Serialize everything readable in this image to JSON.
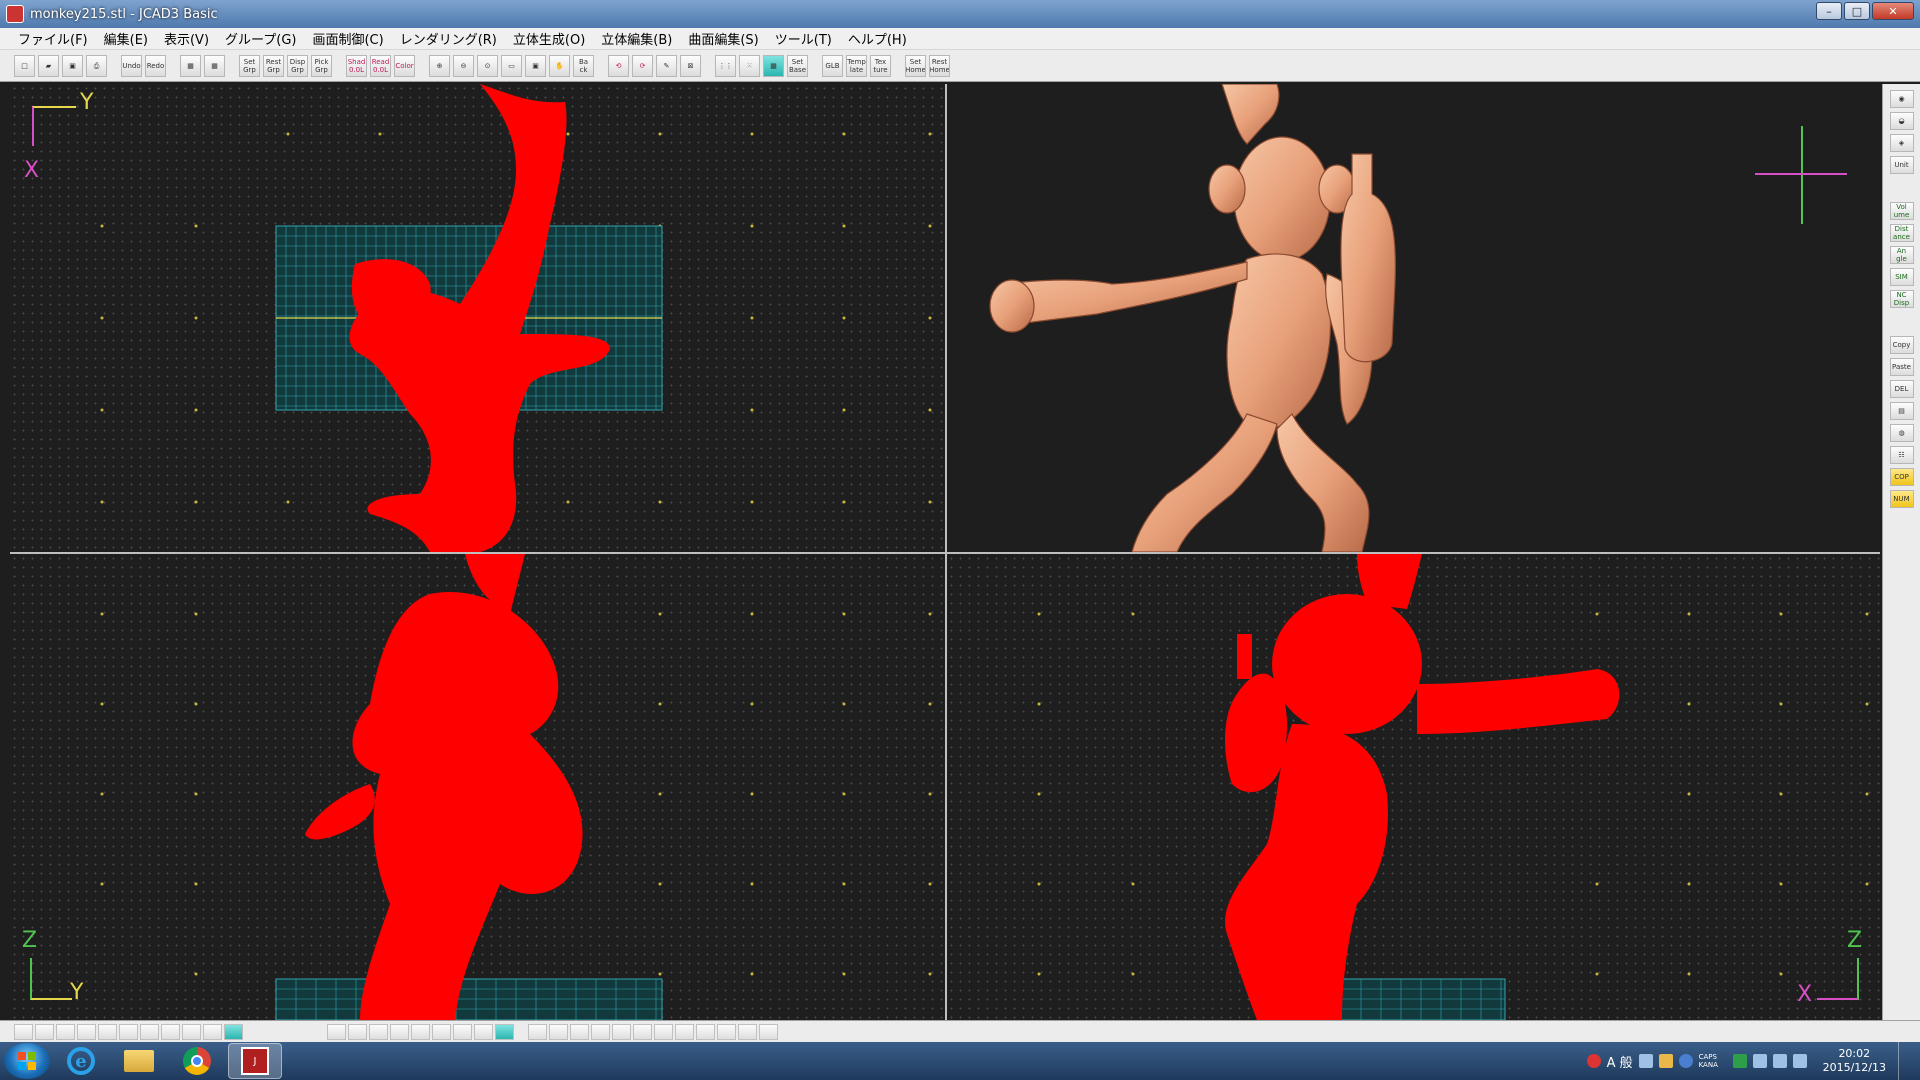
{
  "window": {
    "title": "monkey215.stl - JCAD3 Basic",
    "controls": {
      "minimize": "–",
      "maximize": "□",
      "close": "✕"
    }
  },
  "menu": {
    "items": [
      "ファイル(F)",
      "編集(E)",
      "表示(V)",
      "グループ(G)",
      "画面制御(C)",
      "レンダリング(R)",
      "立体生成(O)",
      "立体編集(B)",
      "曲面編集(S)",
      "ツール(T)",
      "ヘルプ(H)"
    ]
  },
  "toolbar": {
    "groups": [
      [
        "new",
        "open",
        "save",
        "print"
      ],
      [
        "Undo",
        "Redo"
      ],
      [
        "grid1",
        "grid2"
      ],
      [
        "Set Grp",
        "Rest Grp",
        "Disp Grp",
        "Pick Grp"
      ],
      [
        "Shad 0.0L",
        "Read 0.0L",
        "Color"
      ],
      [
        "zoom-in",
        "zoom-out",
        "zoom-fit",
        "zoom-window",
        "zoom-all",
        "pan",
        "Ba ck"
      ],
      [
        "rot1",
        "rot2",
        "rot3",
        "rot4"
      ],
      [
        "grid-a",
        "grid-b",
        "grid-c",
        "Set Base"
      ],
      [
        "GLB",
        "Temp late",
        "Tex ture"
      ],
      [
        "Set Home",
        "Rest Home"
      ]
    ]
  },
  "viewports": {
    "top_left": {
      "axis_h": "Y",
      "axis_v": "X",
      "view": "plan"
    },
    "top_right": {
      "view": "shaded-perspective"
    },
    "bottom_left": {
      "axis_h": "Y",
      "axis_v": "Z",
      "view": "side"
    },
    "bottom_right": {
      "axis_h": "X",
      "axis_v": "Z",
      "view": "front"
    }
  },
  "right_palette": {
    "buttons": [
      "eye",
      "bowl",
      "cube",
      "Unit",
      "Vol ume",
      "Dist ance",
      "An gle",
      "SIM",
      "NC Disp",
      "Copy",
      "Paste",
      "DEL",
      "icon-a",
      "icon-b",
      "icon-c",
      "COP",
      "NUM"
    ]
  },
  "taskbar": {
    "apps": [
      "start",
      "internet-explorer",
      "file-explorer",
      "chrome",
      "jcad3"
    ],
    "tray": {
      "ime": "A 般",
      "caps": "CAPS KANA",
      "time": "20:02",
      "date": "2015/12/13"
    }
  },
  "colors": {
    "wireframe": "#ff0000",
    "shaded_model": "#e8a17a",
    "grid_cyan": "#2fa6b0",
    "grid_dot": "#c8b83a",
    "axis_yellow": "#e6d84a",
    "axis_green": "#4fc44f",
    "axis_magenta": "#d64fc4"
  }
}
